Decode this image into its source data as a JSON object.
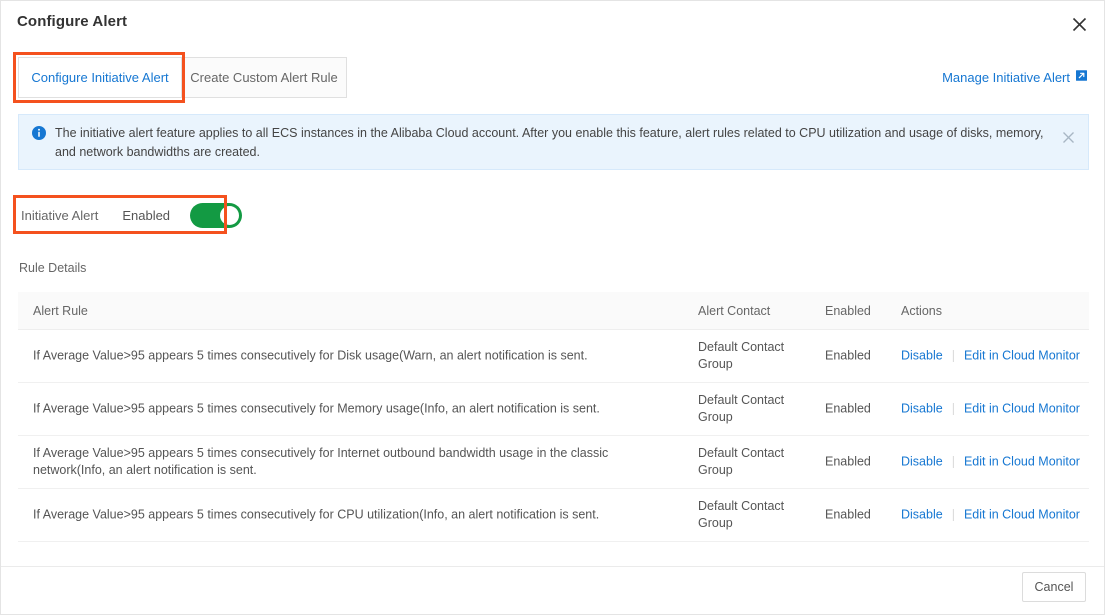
{
  "dialog": {
    "title": "Configure Alert",
    "close_icon": "close-icon"
  },
  "tabs": [
    {
      "label": "Configure Initiative Alert",
      "active": true
    },
    {
      "label": "Create Custom Alert Rule",
      "active": false
    }
  ],
  "manage_link": {
    "label": "Manage Initiative Alert",
    "icon": "external-link-icon"
  },
  "banner": {
    "icon": "info-circle-icon",
    "text": "The initiative alert feature applies to all ECS instances in the Alibaba Cloud account. After you enable this feature, alert rules related to CPU utilization and usage of disks, memory, and network bandwidths are created.",
    "close_icon": "close-icon"
  },
  "toggle": {
    "label": "Initiative Alert",
    "state": "Enabled",
    "on": true
  },
  "rule_details": {
    "section_label": "Rule Details",
    "columns": [
      "Alert Rule",
      "Alert Contact",
      "Enabled",
      "Actions"
    ],
    "rows": [
      {
        "rule": "If Average Value>95 appears 5 times consecutively for Disk usage(Warn, an alert notification is sent.",
        "contact": "Default Contact Group",
        "enabled": "Enabled",
        "action_disable": "Disable",
        "action_edit": "Edit in Cloud Monitor"
      },
      {
        "rule": "If Average Value>95 appears 5 times consecutively for Memory usage(Info, an alert notification is sent.",
        "contact": "Default Contact Group",
        "enabled": "Enabled",
        "action_disable": "Disable",
        "action_edit": "Edit in Cloud Monitor"
      },
      {
        "rule": "If Average Value>95 appears 5 times consecutively for Internet outbound bandwidth usage in the classic network(Info, an alert notification is sent.",
        "contact": "Default Contact Group",
        "enabled": "Enabled",
        "action_disable": "Disable",
        "action_edit": "Edit in Cloud Monitor"
      },
      {
        "rule": "If Average Value>95 appears 5 times consecutively for CPU utilization(Info, an alert notification is sent.",
        "contact": "Default Contact Group",
        "enabled": "Enabled",
        "action_disable": "Disable",
        "action_edit": "Edit in Cloud Monitor"
      }
    ]
  },
  "footer": {
    "cancel_label": "Cancel"
  },
  "colors": {
    "link": "#1677d2",
    "toggle_on": "#139a43",
    "annotation": "#f4511e",
    "banner_bg": "#eaf4fd"
  }
}
